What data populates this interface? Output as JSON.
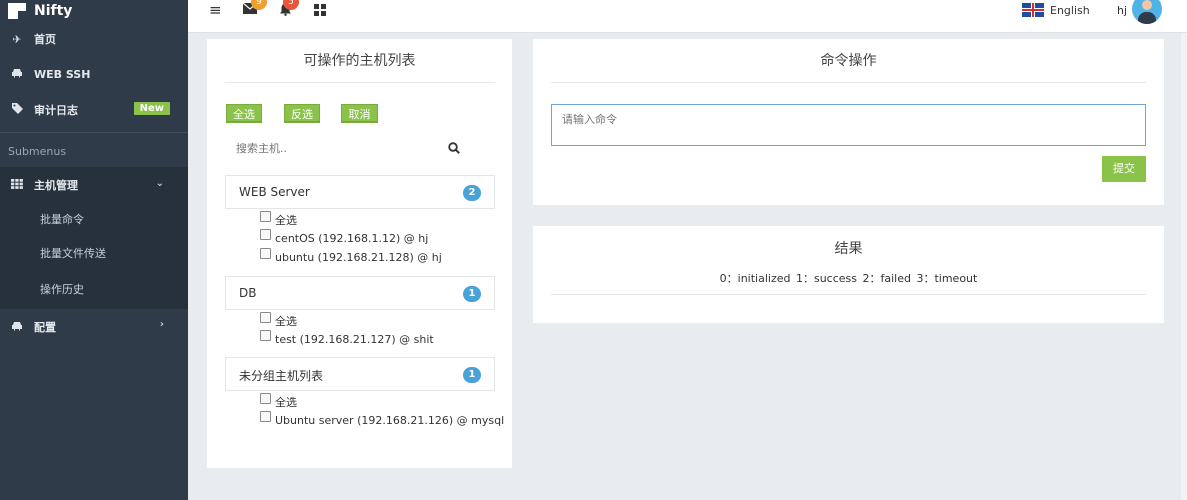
{
  "brand": {
    "name": "Nifty"
  },
  "sidebar": {
    "items": [
      {
        "label": "首页",
        "icon": "plane-icon"
      },
      {
        "label": "WEB SSH",
        "icon": "car-icon"
      },
      {
        "label": "审计日志",
        "icon": "tag-icon",
        "badge": "New"
      }
    ],
    "submenus_label": "Submenus",
    "host_group": {
      "label": "主机管理",
      "children": [
        "批量命令",
        "批量文件传送",
        "操作历史"
      ]
    },
    "config": {
      "label": "配置"
    }
  },
  "topbar": {
    "mail_count": "9",
    "notify_count": "5",
    "language": "English",
    "username": "hj"
  },
  "host_panel": {
    "title": "可操作的主机列表",
    "buttons": {
      "select_all": "全选",
      "invert": "反选",
      "cancel": "取消"
    },
    "search_placeholder": "搜索主机..",
    "groups": [
      {
        "name": "WEB Server",
        "count": "2",
        "select_all": "全选",
        "hosts": [
          "centOS (192.168.1.12) @ hj",
          "ubuntu (192.168.21.128) @ hj"
        ]
      },
      {
        "name": "DB",
        "count": "1",
        "select_all": "全选",
        "hosts": [
          "test (192.168.21.127) @ shit"
        ]
      },
      {
        "name": "未分组主机列表",
        "count": "1",
        "select_all": "全选",
        "hosts": [
          "Ubuntu server (192.168.21.126) @ mysql"
        ]
      }
    ]
  },
  "command_panel": {
    "title": "命令操作",
    "placeholder": "请输入命令",
    "submit_label": "提交"
  },
  "result_panel": {
    "title": "结果",
    "legend": "0：initialized  1：success  2：failed  3：timeout"
  },
  "colors": {
    "sidebar_bg": "#2f3b48",
    "accent_green": "#8bc34a",
    "badge_blue": "#4aa3d8"
  }
}
